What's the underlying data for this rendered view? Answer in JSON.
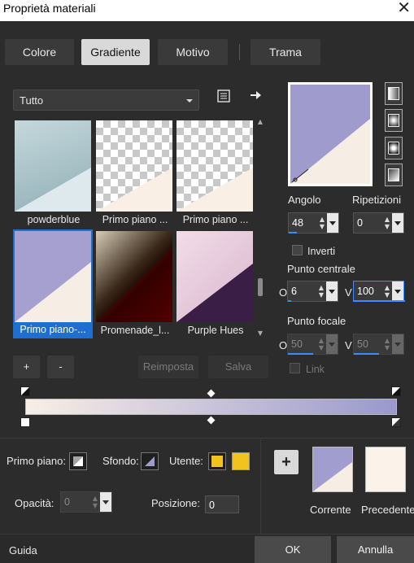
{
  "window": {
    "title": "Proprietà materiali",
    "close_glyph": "✕"
  },
  "tabs": [
    {
      "label": "Colore",
      "active": false
    },
    {
      "label": "Gradiente",
      "active": true
    },
    {
      "label": "Motivo",
      "active": false
    },
    {
      "label": "Trama",
      "active": false
    }
  ],
  "library": {
    "category": "Tutto",
    "items": [
      {
        "label": "powderblue",
        "selected": false
      },
      {
        "label": "Primo piano ...",
        "selected": false
      },
      {
        "label": "Primo piano ...",
        "selected": false
      },
      {
        "label": "Primo piano-...",
        "selected": true
      },
      {
        "label": "Promenade_l...",
        "selected": false
      },
      {
        "label": "Purple Hues",
        "selected": false
      }
    ],
    "add_label": "+",
    "remove_label": "-",
    "reset_label": "Reimposta",
    "save_label": "Salva"
  },
  "settings": {
    "angle_label": "Angolo",
    "angle_value": "48",
    "repeat_label": "Ripetizioni",
    "repeat_value": "0",
    "invert_label": "Inverti",
    "center_label": "Punto centrale",
    "center_h_label": "O",
    "center_h_value": "6",
    "center_v_label": "V",
    "center_v_value": "100",
    "focal_label": "Punto focale",
    "focal_h_label": "O",
    "focal_h_value": "50",
    "focal_v_label": "V",
    "focal_v_value": "50",
    "link_label": "Link"
  },
  "bottom": {
    "foreground_label": "Primo piano:",
    "background_label": "Sfondo:",
    "user_label": "Utente:",
    "opacity_label": "Opacità:",
    "opacity_value": "0",
    "position_label": "Posizione:",
    "position_value": "0",
    "add_label": "+",
    "current_label": "Corrente",
    "previous_label": "Precedente"
  },
  "footer": {
    "help_label": "Guida",
    "ok_label": "OK",
    "cancel_label": "Annulla"
  },
  "colors": {
    "gradient_start": "#f8efe6",
    "gradient_end": "#9a98cc",
    "accent": "#1e6fd0",
    "user_color": "#f2c21f"
  }
}
